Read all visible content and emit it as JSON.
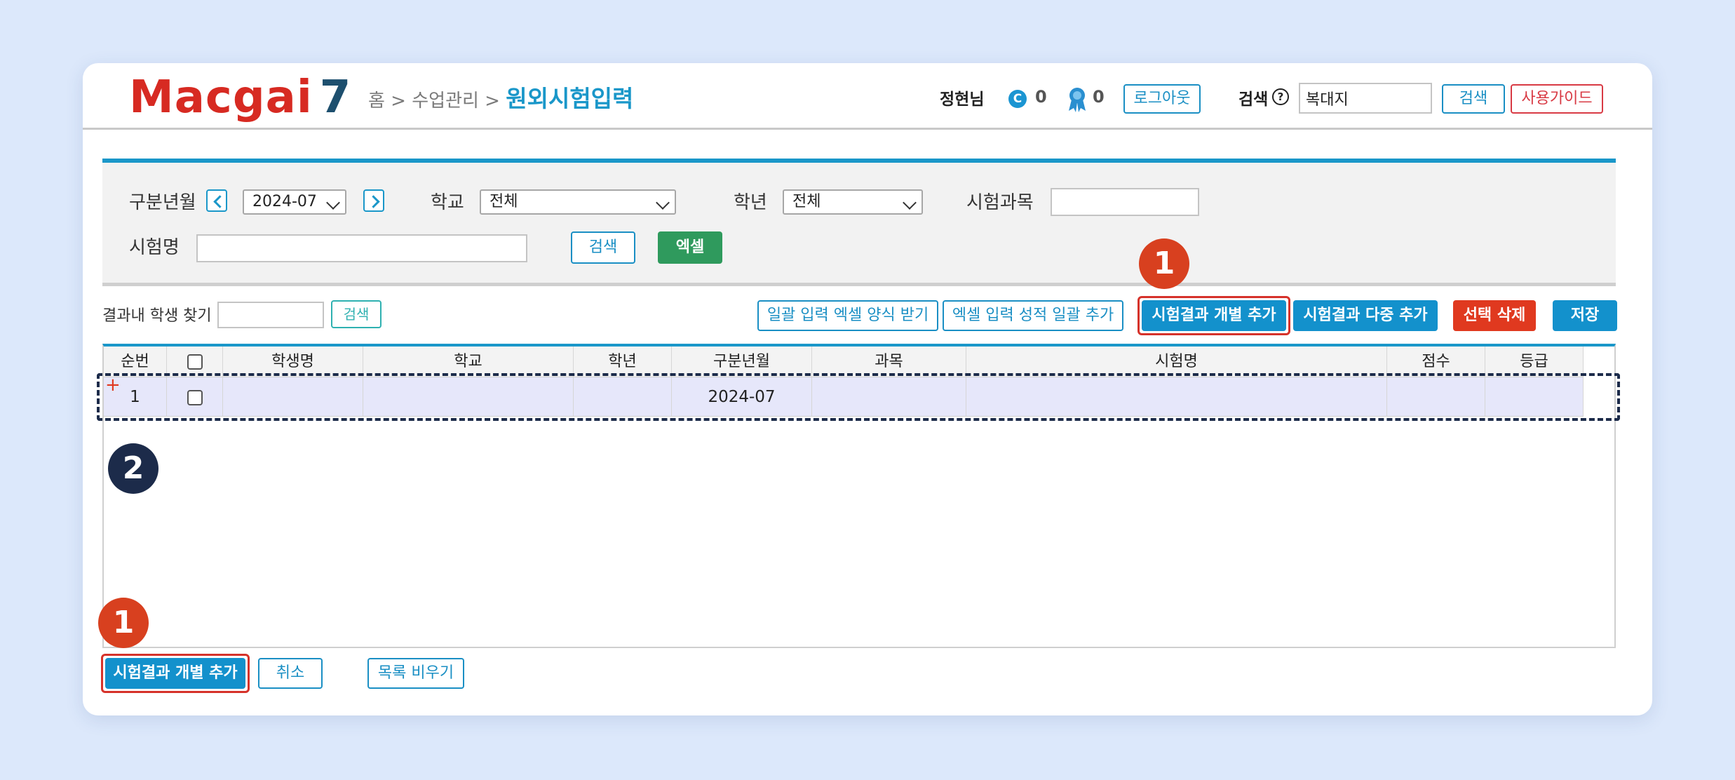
{
  "header": {
    "logo_text": "Macgai",
    "logo_num": "7",
    "breadcrumb": "홈 > 수업관리 > ",
    "page_title": "원외시험입력",
    "user_name": "정현님",
    "coin_icon": "C",
    "coin_count": "0",
    "badge_count": "0",
    "logout": "로그아웃",
    "search_label": "검색",
    "help_icon": "?",
    "search_value": "복대지",
    "search_button": "검색",
    "guide_button": "사용가이드"
  },
  "filters": {
    "period_label": "구분년월",
    "period_value": "2024-07",
    "school_label": "학교",
    "school_value": "전체",
    "grade_label": "학년",
    "grade_value": "전체",
    "subject_label": "시험과목",
    "subject_value": "",
    "exam_label": "시험명",
    "exam_value": "",
    "search_button": "검색",
    "excel_button": "엑셀"
  },
  "toolbar": {
    "find_label": "결과내 학생 찾기",
    "find_value": "",
    "find_button": "검색",
    "download_template": "일괄 입력 엑셀 양식 받기",
    "excel_bulk_add": "엑셀 입력 성적 일괄 추가",
    "add_single": "시험결과 개별 추가",
    "add_multi": "시험결과 다중 추가",
    "delete_selected": "선택 삭제",
    "save": "저장"
  },
  "table": {
    "headers": [
      "순번",
      "",
      "학생명",
      "학교",
      "학년",
      "구분년월",
      "과목",
      "시험명",
      "점수",
      "등급"
    ],
    "rows": [
      {
        "no": "1",
        "name": "",
        "school": "",
        "grade": "",
        "period": "2024-07",
        "subject": "",
        "exam": "",
        "score": "",
        "rank": ""
      }
    ],
    "new_row_marker": "+"
  },
  "bottom": {
    "add_single": "시험결과 개별 추가",
    "cancel": "취소",
    "clear_list": "목록 비우기"
  },
  "annotations": {
    "badge_one": "1",
    "badge_two": "2",
    "badge_one_color": "#d8401f",
    "badge_two_color": "#1c2b4a"
  },
  "colors": {
    "accent": "#1a97c9",
    "primary_button": "#1391cc",
    "excel_button": "#2f9a5d",
    "danger_button": "#e0391f",
    "row_highlight": "#e6e7fa",
    "page_bg": "#dce8fb"
  }
}
